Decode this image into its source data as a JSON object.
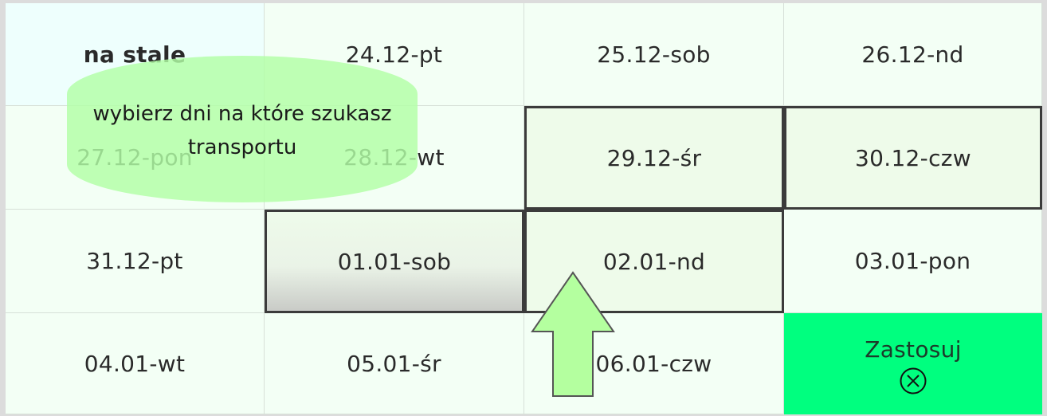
{
  "grid": {
    "cells": [
      {
        "label": "na stale"
      },
      {
        "label": "24.12-pt"
      },
      {
        "label": "25.12-sob"
      },
      {
        "label": "26.12-nd"
      },
      {
        "label": "27.12-pon"
      },
      {
        "label": "28.12-wt"
      },
      {
        "label": "29.12-śr",
        "selected": true
      },
      {
        "label": "30.12-czw",
        "selected": true
      },
      {
        "label": "31.12-pt"
      },
      {
        "label": "01.01-sob",
        "selected": true
      },
      {
        "label": "02.01-nd",
        "selected": true
      },
      {
        "label": "03.01-pon"
      },
      {
        "label": "04.01-wt"
      },
      {
        "label": "05.01-śr"
      },
      {
        "label": "06.01-czw"
      }
    ],
    "apply": {
      "label": "Zastosuj",
      "icon": "close-circle-icon",
      "color": "#00ff7f"
    }
  },
  "tooltip": {
    "text": "wybierz dni na które szukasz transportu"
  },
  "arrow": {
    "icon": "up-arrow-icon",
    "color": "#b4ff9f"
  }
}
